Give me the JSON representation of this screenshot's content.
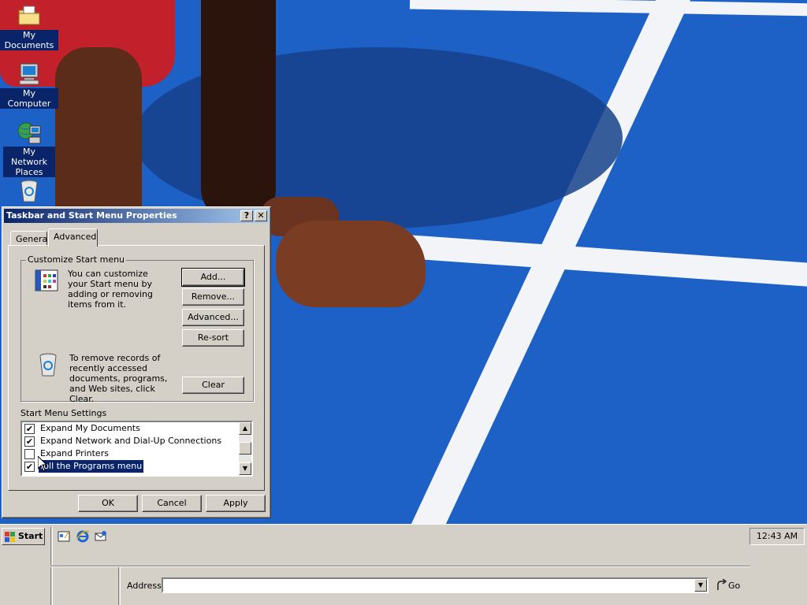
{
  "desktop": {
    "icons": [
      {
        "label": "My Documents",
        "icon": "folder-icon"
      },
      {
        "label": "My Computer",
        "icon": "computer-icon"
      },
      {
        "label": "My Network Places",
        "icon": "network-icon"
      },
      {
        "label": "",
        "icon": "recycle-bin-icon"
      }
    ]
  },
  "dialog": {
    "title": "Taskbar and Start Menu Properties",
    "help_glyph": "?",
    "close_glyph": "✕",
    "tabs": [
      {
        "label": "General",
        "active": false
      },
      {
        "label": "Advanced",
        "active": true
      }
    ],
    "customize": {
      "group_title": "Customize Start menu",
      "description": "You can customize your Start menu by adding or removing items from it.",
      "add_button": "Add...",
      "remove_button": "Remove...",
      "advanced_button": "Advanced...",
      "resort_button": "Re-sort",
      "clear_description": "To remove records of recently accessed documents, programs, and Web sites,  click Clear.",
      "clear_button": "Clear"
    },
    "settings": {
      "title": "Start Menu Settings",
      "items": [
        {
          "label": "Expand My Documents",
          "checked": true,
          "selected": false
        },
        {
          "label": "Expand Network and Dial-Up Connections",
          "checked": true,
          "selected": false
        },
        {
          "label": "Expand Printers",
          "checked": false,
          "selected": false
        },
        {
          "label": "roll the Programs menu",
          "checked": true,
          "selected": true
        }
      ]
    },
    "ok_button": "OK",
    "cancel_button": "Cancel",
    "apply_button": "Apply"
  },
  "taskbar": {
    "start_label": "Start",
    "clock": "12:43 AM",
    "address_label": "Address",
    "address_value": "",
    "go_label": "Go",
    "quick_launch": [
      "show-desktop-icon",
      "internet-explorer-icon",
      "outlook-express-icon"
    ]
  },
  "colors": {
    "selection": "#0a246a",
    "dialog_face": "#d4d0c8",
    "wallpaper_track": "#1d61c6"
  }
}
